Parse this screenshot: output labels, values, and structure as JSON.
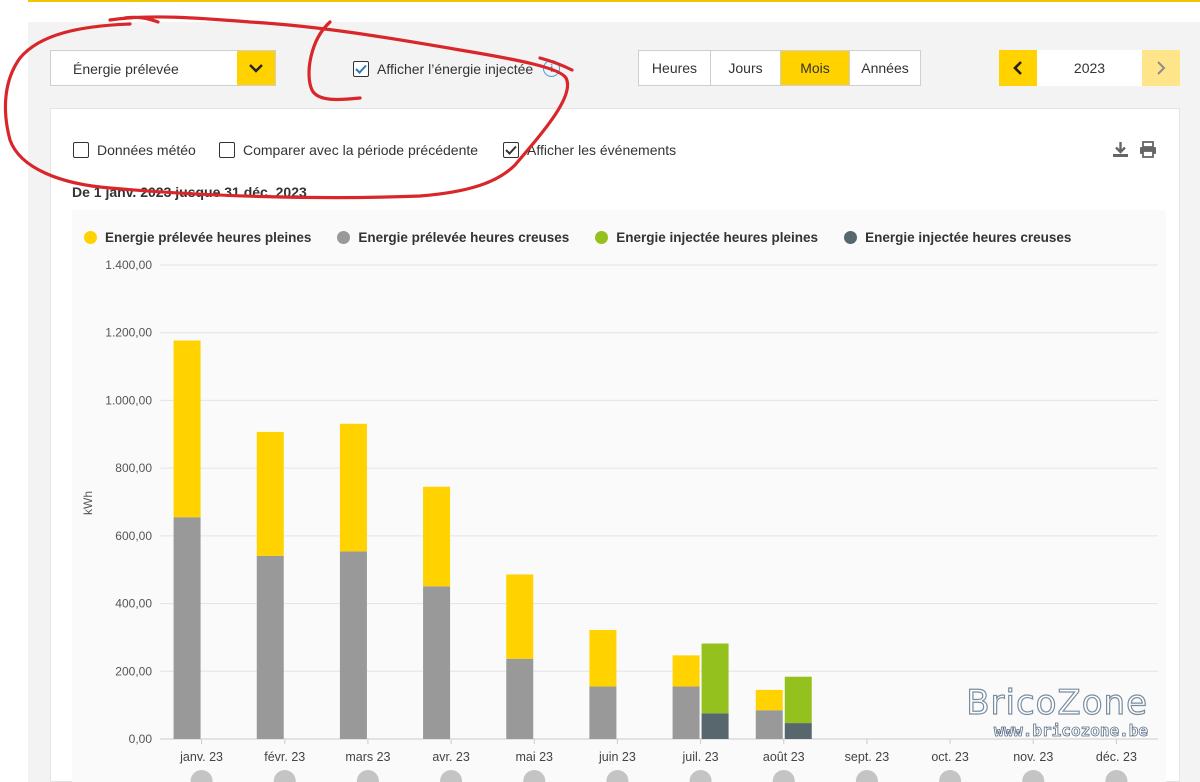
{
  "toolbar": {
    "energy_select": "Énergie prélevée",
    "show_injected_label": "Afficher l’énergie injectée",
    "show_injected_checked": true,
    "info_icon": "info-icon",
    "tabs": [
      {
        "label": "Heures",
        "active": false
      },
      {
        "label": "Jours",
        "active": false
      },
      {
        "label": "Mois",
        "active": true
      },
      {
        "label": "Années",
        "active": false
      }
    ],
    "year": "2023"
  },
  "options": {
    "weather_label": "Données météo",
    "weather_checked": false,
    "compare_label": "Comparer avec la période précédente",
    "compare_checked": false,
    "events_label": "Afficher les événements",
    "events_checked": true
  },
  "actions": {
    "download_icon": "download-icon",
    "print_icon": "print-icon"
  },
  "period_text": "De 1 janv. 2023 jusque 31 déc. 2023",
  "watermark": {
    "brand": "BricoZone",
    "url": "www.bricozone.be"
  },
  "colors": {
    "accent": "#ffd200",
    "peak_taken": "#ffd200",
    "offpeak_taken": "#999999",
    "peak_injected": "#95c11f",
    "offpeak_injected": "#58666e",
    "annotation": "#d9262a"
  },
  "chart_data": {
    "type": "bar",
    "stacked": true,
    "ylabel": "kWh",
    "ylim": [
      0,
      1400
    ],
    "yticks": [
      0,
      200,
      400,
      600,
      800,
      1000,
      1200,
      1400
    ],
    "ytick_labels": [
      "0,00",
      "200,00",
      "400,00",
      "600,00",
      "800,00",
      "1.000,00",
      "1.200,00",
      "1.400,00"
    ],
    "categories": [
      "janv. 23",
      "févr. 23",
      "mars 23",
      "avr. 23",
      "mai 23",
      "juin 23",
      "juil. 23",
      "août 23",
      "sept. 23",
      "oct. 23",
      "nov. 23",
      "déc. 23"
    ],
    "legend_position": "top",
    "grid": true,
    "series": [
      {
        "name": "Energie prélevée heures pleines",
        "stack": "taken",
        "color": "#ffd200",
        "values": [
          522,
          366,
          377,
          294,
          249,
          167,
          92,
          60,
          0,
          0,
          0,
          0
        ]
      },
      {
        "name": "Energie prélevée heures creuses",
        "stack": "taken",
        "color": "#999999",
        "values": [
          655,
          541,
          554,
          451,
          237,
          155,
          155,
          85,
          0,
          0,
          0,
          0
        ]
      },
      {
        "name": "Energie injectée heures pleines",
        "stack": "injected",
        "color": "#95c11f",
        "values": [
          0,
          0,
          0,
          0,
          0,
          0,
          206,
          137,
          0,
          0,
          0,
          0
        ]
      },
      {
        "name": "Energie injectée heures creuses",
        "stack": "injected",
        "color": "#58666e",
        "values": [
          0,
          0,
          0,
          0,
          0,
          0,
          76,
          47,
          0,
          0,
          0,
          0
        ]
      }
    ]
  }
}
